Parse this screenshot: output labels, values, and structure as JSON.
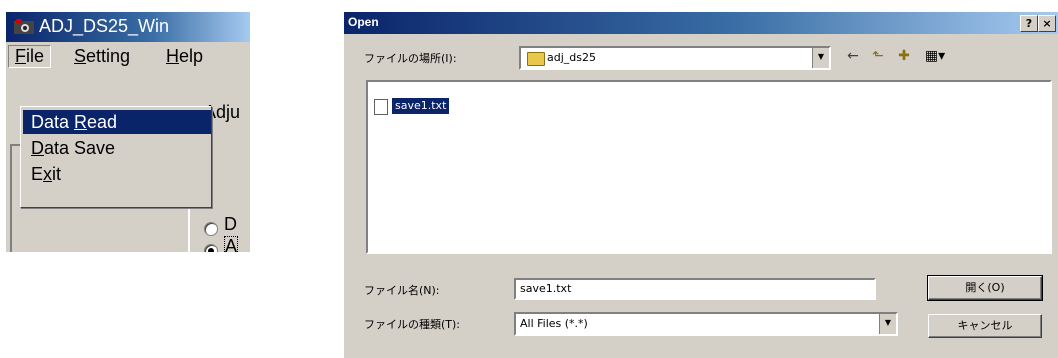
{
  "app_window": {
    "title": "ADJ_DS25_Win",
    "icon": "app-camera-icon",
    "menubar": {
      "file": {
        "prefix": "",
        "accel": "F",
        "suffix": "ile"
      },
      "setting": {
        "prefix": "",
        "accel": "S",
        "suffix": "etting"
      },
      "help": {
        "prefix": "",
        "accel": "H",
        "suffix": "elp"
      }
    },
    "file_menu": {
      "data_read": {
        "prefix": "Data ",
        "accel": "R",
        "suffix": "ead"
      },
      "data_save": {
        "prefix": "",
        "accel": "D",
        "suffix": "ata Save"
      },
      "exit": {
        "prefix": "E",
        "accel": "x",
        "suffix": "it"
      }
    },
    "body": {
      "adjust_label": "Adju",
      "radio_d_label": "D",
      "radio_a_label": "A"
    }
  },
  "open_dialog": {
    "title": "Open",
    "help_button": "?",
    "close_button": "×",
    "look_in_label": "ファイルの場所(I):",
    "look_in_value": "adj_ds25",
    "toolbar": {
      "back_icon": "←",
      "up_icon": "⬑",
      "new_folder_icon": "✚",
      "view_icon": "▦▾"
    },
    "files": [
      {
        "name": "save1.txt",
        "selected": true,
        "icon": "text-file-icon"
      }
    ],
    "filename_label": "ファイル名(N):",
    "filename_value": "save1.txt",
    "filetype_label": "ファイルの種類(T):",
    "filetype_value": "All Files (*.*)",
    "open_button": "開く(O)",
    "cancel_button": "キャンセル"
  }
}
